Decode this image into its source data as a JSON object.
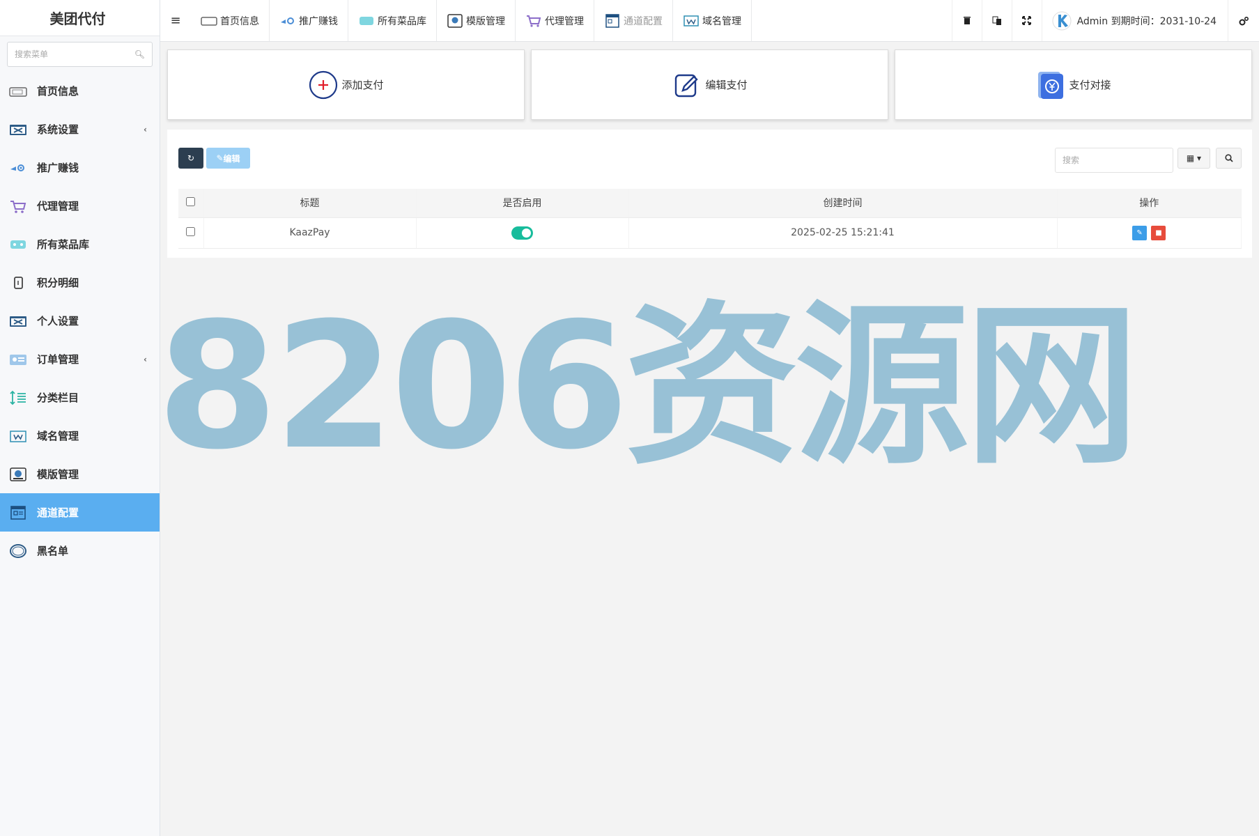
{
  "brand": "美团代付",
  "sidebar": {
    "search_placeholder": "搜索菜单",
    "items": [
      {
        "label": "首页信息"
      },
      {
        "label": "系统设置"
      },
      {
        "label": "推广赚钱"
      },
      {
        "label": "代理管理"
      },
      {
        "label": "所有菜品库"
      },
      {
        "label": "积分明细"
      },
      {
        "label": "个人设置"
      },
      {
        "label": "订单管理"
      },
      {
        "label": "分类栏目"
      },
      {
        "label": "域名管理"
      },
      {
        "label": "模版管理"
      },
      {
        "label": "通道配置"
      },
      {
        "label": "黑名单"
      }
    ],
    "active_color": "#5aaef0"
  },
  "topbar": {
    "tabs": [
      {
        "label": "首页信息"
      },
      {
        "label": "推广赚钱"
      },
      {
        "label": "所有菜品库"
      },
      {
        "label": "模版管理"
      },
      {
        "label": "代理管理"
      },
      {
        "label": "通道配置"
      },
      {
        "label": "域名管理"
      }
    ],
    "user_text": "Admin 到期时间：2031-10-24"
  },
  "cards": [
    {
      "label": "添加支付"
    },
    {
      "label": "编辑支付"
    },
    {
      "label": "支付对接"
    }
  ],
  "toolbar": {
    "edit_label": "编辑",
    "search_placeholder": "搜索"
  },
  "table": {
    "headers": [
      "标题",
      "是否启用",
      "创建时间",
      "操作"
    ],
    "rows": [
      {
        "title": "KaazPay",
        "enabled": true,
        "created": "2025-02-25 15:21:41"
      }
    ]
  },
  "watermark": "8206资源网"
}
